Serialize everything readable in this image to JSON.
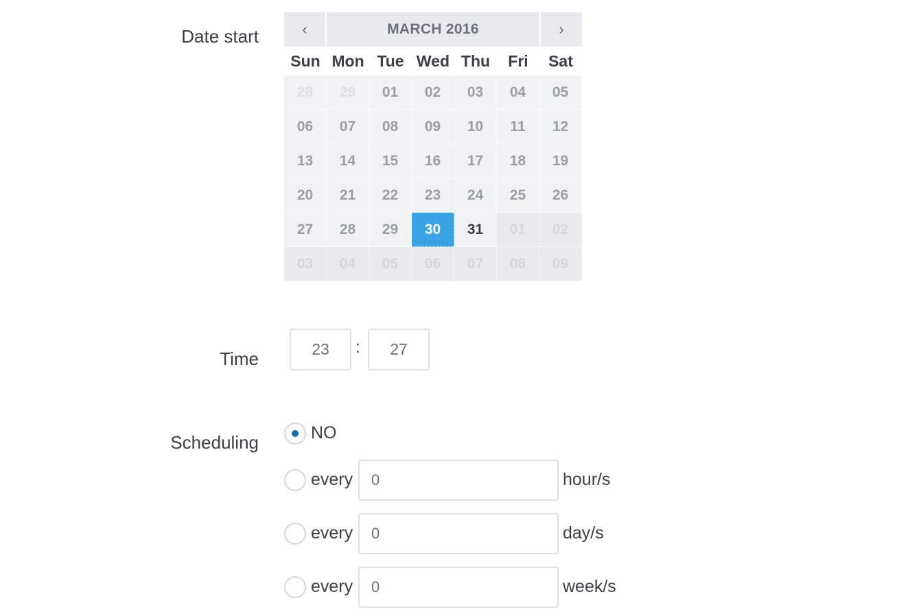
{
  "date_start": {
    "label": "Date start",
    "calendar": {
      "month_title": "MARCH 2016",
      "prev": "‹",
      "next": "›",
      "weekdays": [
        "Sun",
        "Mon",
        "Tue",
        "Wed",
        "Thu",
        "Fri",
        "Sat"
      ],
      "days": [
        {
          "d": "28",
          "s": "other"
        },
        {
          "d": "29",
          "s": "other"
        },
        {
          "d": "01",
          "s": ""
        },
        {
          "d": "02",
          "s": ""
        },
        {
          "d": "03",
          "s": ""
        },
        {
          "d": "04",
          "s": ""
        },
        {
          "d": "05",
          "s": ""
        },
        {
          "d": "06",
          "s": ""
        },
        {
          "d": "07",
          "s": ""
        },
        {
          "d": "08",
          "s": ""
        },
        {
          "d": "09",
          "s": ""
        },
        {
          "d": "10",
          "s": ""
        },
        {
          "d": "11",
          "s": ""
        },
        {
          "d": "12",
          "s": ""
        },
        {
          "d": "13",
          "s": ""
        },
        {
          "d": "14",
          "s": ""
        },
        {
          "d": "15",
          "s": ""
        },
        {
          "d": "16",
          "s": ""
        },
        {
          "d": "17",
          "s": ""
        },
        {
          "d": "18",
          "s": ""
        },
        {
          "d": "19",
          "s": ""
        },
        {
          "d": "20",
          "s": ""
        },
        {
          "d": "21",
          "s": ""
        },
        {
          "d": "22",
          "s": ""
        },
        {
          "d": "23",
          "s": ""
        },
        {
          "d": "24",
          "s": ""
        },
        {
          "d": "25",
          "s": ""
        },
        {
          "d": "26",
          "s": ""
        },
        {
          "d": "27",
          "s": ""
        },
        {
          "d": "28",
          "s": ""
        },
        {
          "d": "29",
          "s": ""
        },
        {
          "d": "30",
          "s": "selected"
        },
        {
          "d": "31",
          "s": "today"
        },
        {
          "d": "01",
          "s": "after"
        },
        {
          "d": "02",
          "s": "after"
        },
        {
          "d": "03",
          "s": "after"
        },
        {
          "d": "04",
          "s": "after"
        },
        {
          "d": "05",
          "s": "after"
        },
        {
          "d": "06",
          "s": "after"
        },
        {
          "d": "07",
          "s": "after"
        },
        {
          "d": "08",
          "s": "after"
        },
        {
          "d": "09",
          "s": "after"
        }
      ]
    }
  },
  "time": {
    "label": "Time",
    "hour": "23",
    "separator": ":",
    "minute": "27"
  },
  "scheduling": {
    "label": "Scheduling",
    "no_option": "NO",
    "every_label": "every",
    "hours": {
      "value": "0",
      "unit": "hour/s"
    },
    "days": {
      "value": "0",
      "unit": "day/s"
    },
    "weeks": {
      "value": "0",
      "unit": "week/s"
    }
  },
  "colors": {
    "selected_day": "#3aa3e3",
    "radio_dot": "#1b6fb0"
  }
}
